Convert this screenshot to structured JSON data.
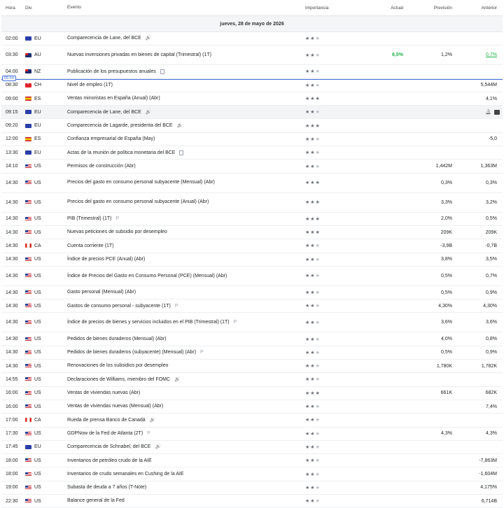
{
  "header": {
    "time": "Hora",
    "currency": "Div.",
    "event": "Evento",
    "importance": "Importancia",
    "actual": "Actual",
    "forecast": "Previsión",
    "previous": "Anterior"
  },
  "date_label": "jueves, 28 de mayo de 2026",
  "now_time": "05:54",
  "colors": {
    "positive": "#1fb34b",
    "now_line": "#3f6fd8",
    "highlight_row": "#f3f4f6"
  },
  "rows": [
    {
      "time": "02:00",
      "cur": "EU",
      "flag": "eu",
      "event": "Comparecencia de Lane, del BCE",
      "icon": "speaker-icon",
      "stars": 2,
      "actual": "",
      "forecast": "",
      "previous": ""
    },
    {
      "time": "03:30",
      "cur": "AU",
      "flag": "au",
      "event": "Nuevas inversiones privadas en bienes de capital (Trimestral) (1T)",
      "icon": "",
      "stars": 2,
      "actual": "6,5%",
      "forecast": "1,2%",
      "previous": "0,7%"
    },
    {
      "time": "04:00",
      "cur": "NZ",
      "flag": "nz",
      "event": "Publicación de los presupuestos anuales",
      "icon": "document-icon",
      "stars": 2,
      "actual": "",
      "forecast": "",
      "previous": ""
    },
    {
      "time": "08:30",
      "cur": "CH",
      "flag": "ch",
      "event": "Nivel de empleo (1T)",
      "icon": "",
      "stars": 2,
      "actual": "",
      "forecast": "",
      "previous": "5,544M"
    },
    {
      "time": "09:00",
      "cur": "ES",
      "flag": "es",
      "event": "Ventas minoristas en España (Anual) (Abr)",
      "icon": "",
      "stars": 3,
      "actual": "",
      "forecast": "",
      "previous": "4,1%"
    },
    {
      "time": "09:15",
      "cur": "EU",
      "flag": "eu",
      "event": "Comparecencia de Lane, del BCE",
      "icon": "speaker-icon",
      "stars": 2,
      "actual": "",
      "forecast": "",
      "previous": ""
    },
    {
      "time": "09:20",
      "cur": "EU",
      "flag": "eu",
      "event": "Comparecencia de Lagarde, presidenta del BCE",
      "icon": "speaker-icon",
      "stars": 3,
      "actual": "",
      "forecast": "",
      "previous": ""
    },
    {
      "time": "12:00",
      "cur": "ES",
      "flag": "es",
      "event": "Confianza empresarial de España (May)",
      "icon": "",
      "stars": 2,
      "actual": "",
      "forecast": "",
      "previous": "-5,0"
    },
    {
      "time": "13:30",
      "cur": "EU",
      "flag": "eu",
      "event": "Actas de la reunión de política monetaria del BCE",
      "icon": "document-icon",
      "stars": 2,
      "actual": "",
      "forecast": "",
      "previous": ""
    },
    {
      "time": "14:10",
      "cur": "US",
      "flag": "us",
      "event": "Permisos de construcción (Abr)",
      "icon": "",
      "stars": 2,
      "actual": "",
      "forecast": "1,442M",
      "previous": "1,363M"
    },
    {
      "time": "14:30",
      "cur": "US",
      "flag": "us",
      "event": "Precios del gasto en consumo personal subyacente (Mensual) (Abr)",
      "icon": "",
      "stars": 3,
      "actual": "",
      "forecast": "0,3%",
      "previous": "0,3%"
    },
    {
      "time": "14:30",
      "cur": "US",
      "flag": "us",
      "event": "Precios del gasto en consumo personal subyacente (Anual) (Abr)",
      "icon": "",
      "stars": 3,
      "actual": "",
      "forecast": "3,3%",
      "previous": "3,2%"
    },
    {
      "time": "14:30",
      "cur": "US",
      "flag": "us",
      "event": "PIB (Trimestral) (1T)",
      "icon": "preliminary-icon",
      "stars": 3,
      "actual": "",
      "forecast": "2,0%",
      "previous": "0,5%"
    },
    {
      "time": "14:30",
      "cur": "US",
      "flag": "us",
      "event": "Nuevas peticiones de subsidio por desempleo",
      "icon": "",
      "stars": 3,
      "actual": "",
      "forecast": "209K",
      "previous": "209K"
    },
    {
      "time": "14:30",
      "cur": "CA",
      "flag": "ca",
      "event": "Cuenta corriente (1T)",
      "icon": "",
      "stars": 2,
      "actual": "",
      "forecast": "-3,9B",
      "previous": "-0,7B"
    },
    {
      "time": "14:30",
      "cur": "US",
      "flag": "us",
      "event": "Índice de precios PCE (Anual) (Abr)",
      "icon": "",
      "stars": 2,
      "actual": "",
      "forecast": "3,8%",
      "previous": "3,5%"
    },
    {
      "time": "14:30",
      "cur": "US",
      "flag": "us",
      "event": "Índice de Precios del Gasto en Consumo Personal (PCE) (Mensual) (Abr)",
      "icon": "",
      "stars": 2,
      "actual": "",
      "forecast": "0,5%",
      "previous": "0,7%"
    },
    {
      "time": "14:30",
      "cur": "US",
      "flag": "us",
      "event": "Gasto personal (Mensual) (Abr)",
      "icon": "",
      "stars": 2,
      "actual": "",
      "forecast": "0,5%",
      "previous": "0,9%"
    },
    {
      "time": "14:30",
      "cur": "US",
      "flag": "us",
      "event": "Gastos de consumo personal - subyacente (1T)",
      "icon": "preliminary-icon",
      "stars": 2,
      "actual": "",
      "forecast": "4,30%",
      "previous": "4,30%"
    },
    {
      "time": "14:30",
      "cur": "US",
      "flag": "us",
      "event": "Índice de precios de bienes y servicios incluidos en el PIB (Trimestral) (1T)",
      "icon": "preliminary-icon",
      "stars": 2,
      "actual": "",
      "forecast": "3,6%",
      "previous": "3,6%"
    },
    {
      "time": "14:30",
      "cur": "US",
      "flag": "us",
      "event": "Pedidos de bienes duraderos (Mensual) (Abr)",
      "icon": "",
      "stars": 2,
      "actual": "",
      "forecast": "4,0%",
      "previous": "0,8%"
    },
    {
      "time": "14:30",
      "cur": "US",
      "flag": "us",
      "event": "Pedidos de bienes duraderos (subyacente) (Mensual) (Abr)",
      "icon": "preliminary-icon",
      "stars": 2,
      "actual": "",
      "forecast": "0,5%",
      "previous": "0,9%"
    },
    {
      "time": "14:30",
      "cur": "US",
      "flag": "us",
      "event": "Renovaciones de los subsidios por desempleo",
      "icon": "",
      "stars": 2,
      "actual": "",
      "forecast": "1,780K",
      "previous": "1,782K"
    },
    {
      "time": "14:55",
      "cur": "US",
      "flag": "us",
      "event": "Declaraciones de Williams, miembro del FOMC",
      "icon": "speaker-icon",
      "stars": 2,
      "actual": "",
      "forecast": "",
      "previous": ""
    },
    {
      "time": "16:00",
      "cur": "US",
      "flag": "us",
      "event": "Ventas de viviendas nuevas (Abr)",
      "icon": "",
      "stars": 3,
      "actual": "",
      "forecast": "661K",
      "previous": "682K"
    },
    {
      "time": "16:00",
      "cur": "US",
      "flag": "us",
      "event": "Ventas de viviendas nuevas (Mensual) (Abr)",
      "icon": "",
      "stars": 2,
      "actual": "",
      "forecast": "",
      "previous": "7,4%"
    },
    {
      "time": "17:00",
      "cur": "CA",
      "flag": "ca",
      "event": "Rueda de prensa Banco de Canadá",
      "icon": "speaker-icon",
      "stars": 2,
      "actual": "",
      "forecast": "",
      "previous": ""
    },
    {
      "time": "17:30",
      "cur": "US",
      "flag": "us",
      "event": "GDPNow de la Fed de Atlanta (2T)",
      "icon": "preliminary-icon",
      "stars": 2,
      "actual": "",
      "forecast": "4,3%",
      "previous": "4,3%"
    },
    {
      "time": "17:45",
      "cur": "EU",
      "flag": "eu",
      "event": "Comparecencia de Schnabel, del BCE",
      "icon": "speaker-icon",
      "stars": 2,
      "actual": "",
      "forecast": "",
      "previous": ""
    },
    {
      "time": "18:00",
      "cur": "US",
      "flag": "us",
      "event": "Inventarios de petróleo crudo de la AIE",
      "icon": "",
      "stars": 2,
      "actual": "",
      "forecast": "",
      "previous": "-7,863M"
    },
    {
      "time": "18:00",
      "cur": "US",
      "flag": "us",
      "event": "Inventarios de crudo semanales en Cushing de la AIE",
      "icon": "",
      "stars": 2,
      "actual": "",
      "forecast": "",
      "previous": "-1,604M"
    },
    {
      "time": "19:00",
      "cur": "US",
      "flag": "us",
      "event": "Subasta de deuda a 7 años (T-Note)",
      "icon": "",
      "stars": 2,
      "actual": "",
      "forecast": "",
      "previous": "4,175%"
    },
    {
      "time": "22:30",
      "cur": "US",
      "flag": "us",
      "event": "Balance general de la Fed",
      "icon": "",
      "stars": 2,
      "actual": "",
      "forecast": "",
      "previous": "6,714B"
    }
  ],
  "preliminary_label": "P"
}
